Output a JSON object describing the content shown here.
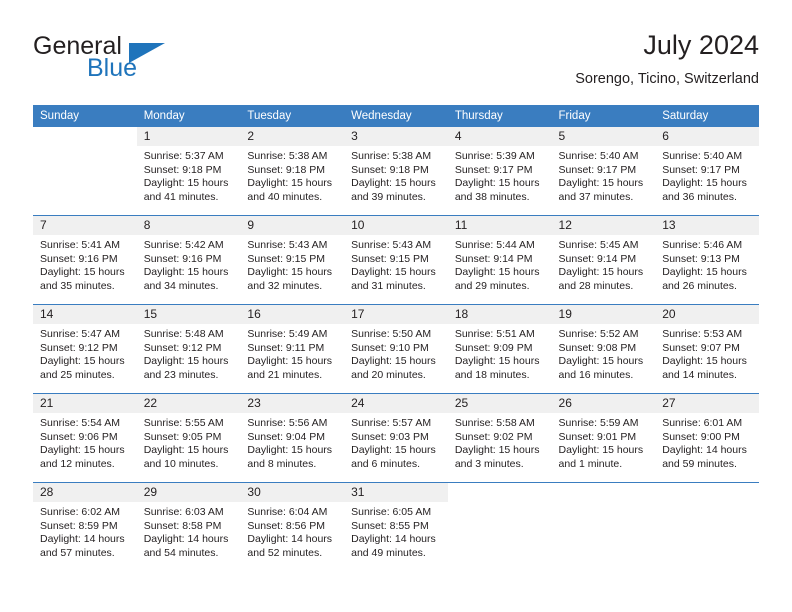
{
  "brand": {
    "name_part1": "General",
    "name_part2": "Blue",
    "triangle_icon": "triangle-icon"
  },
  "header": {
    "title": "July 2024",
    "location": "Sorengo, Ticino, Switzerland"
  },
  "colors": {
    "header_blue": "#3a7dc0",
    "brand_blue": "#1f74bb",
    "daynum_bg": "#f0f0f0",
    "text": "#231f20"
  },
  "weekdays": [
    "Sunday",
    "Monday",
    "Tuesday",
    "Wednesday",
    "Thursday",
    "Friday",
    "Saturday"
  ],
  "weeks": [
    [
      {
        "day": "",
        "sunrise": "",
        "sunset": "",
        "daylight1": "",
        "daylight2": ""
      },
      {
        "day": "1",
        "sunrise": "Sunrise: 5:37 AM",
        "sunset": "Sunset: 9:18 PM",
        "daylight1": "Daylight: 15 hours",
        "daylight2": "and 41 minutes."
      },
      {
        "day": "2",
        "sunrise": "Sunrise: 5:38 AM",
        "sunset": "Sunset: 9:18 PM",
        "daylight1": "Daylight: 15 hours",
        "daylight2": "and 40 minutes."
      },
      {
        "day": "3",
        "sunrise": "Sunrise: 5:38 AM",
        "sunset": "Sunset: 9:18 PM",
        "daylight1": "Daylight: 15 hours",
        "daylight2": "and 39 minutes."
      },
      {
        "day": "4",
        "sunrise": "Sunrise: 5:39 AM",
        "sunset": "Sunset: 9:17 PM",
        "daylight1": "Daylight: 15 hours",
        "daylight2": "and 38 minutes."
      },
      {
        "day": "5",
        "sunrise": "Sunrise: 5:40 AM",
        "sunset": "Sunset: 9:17 PM",
        "daylight1": "Daylight: 15 hours",
        "daylight2": "and 37 minutes."
      },
      {
        "day": "6",
        "sunrise": "Sunrise: 5:40 AM",
        "sunset": "Sunset: 9:17 PM",
        "daylight1": "Daylight: 15 hours",
        "daylight2": "and 36 minutes."
      }
    ],
    [
      {
        "day": "7",
        "sunrise": "Sunrise: 5:41 AM",
        "sunset": "Sunset: 9:16 PM",
        "daylight1": "Daylight: 15 hours",
        "daylight2": "and 35 minutes."
      },
      {
        "day": "8",
        "sunrise": "Sunrise: 5:42 AM",
        "sunset": "Sunset: 9:16 PM",
        "daylight1": "Daylight: 15 hours",
        "daylight2": "and 34 minutes."
      },
      {
        "day": "9",
        "sunrise": "Sunrise: 5:43 AM",
        "sunset": "Sunset: 9:15 PM",
        "daylight1": "Daylight: 15 hours",
        "daylight2": "and 32 minutes."
      },
      {
        "day": "10",
        "sunrise": "Sunrise: 5:43 AM",
        "sunset": "Sunset: 9:15 PM",
        "daylight1": "Daylight: 15 hours",
        "daylight2": "and 31 minutes."
      },
      {
        "day": "11",
        "sunrise": "Sunrise: 5:44 AM",
        "sunset": "Sunset: 9:14 PM",
        "daylight1": "Daylight: 15 hours",
        "daylight2": "and 29 minutes."
      },
      {
        "day": "12",
        "sunrise": "Sunrise: 5:45 AM",
        "sunset": "Sunset: 9:14 PM",
        "daylight1": "Daylight: 15 hours",
        "daylight2": "and 28 minutes."
      },
      {
        "day": "13",
        "sunrise": "Sunrise: 5:46 AM",
        "sunset": "Sunset: 9:13 PM",
        "daylight1": "Daylight: 15 hours",
        "daylight2": "and 26 minutes."
      }
    ],
    [
      {
        "day": "14",
        "sunrise": "Sunrise: 5:47 AM",
        "sunset": "Sunset: 9:12 PM",
        "daylight1": "Daylight: 15 hours",
        "daylight2": "and 25 minutes."
      },
      {
        "day": "15",
        "sunrise": "Sunrise: 5:48 AM",
        "sunset": "Sunset: 9:12 PM",
        "daylight1": "Daylight: 15 hours",
        "daylight2": "and 23 minutes."
      },
      {
        "day": "16",
        "sunrise": "Sunrise: 5:49 AM",
        "sunset": "Sunset: 9:11 PM",
        "daylight1": "Daylight: 15 hours",
        "daylight2": "and 21 minutes."
      },
      {
        "day": "17",
        "sunrise": "Sunrise: 5:50 AM",
        "sunset": "Sunset: 9:10 PM",
        "daylight1": "Daylight: 15 hours",
        "daylight2": "and 20 minutes."
      },
      {
        "day": "18",
        "sunrise": "Sunrise: 5:51 AM",
        "sunset": "Sunset: 9:09 PM",
        "daylight1": "Daylight: 15 hours",
        "daylight2": "and 18 minutes."
      },
      {
        "day": "19",
        "sunrise": "Sunrise: 5:52 AM",
        "sunset": "Sunset: 9:08 PM",
        "daylight1": "Daylight: 15 hours",
        "daylight2": "and 16 minutes."
      },
      {
        "day": "20",
        "sunrise": "Sunrise: 5:53 AM",
        "sunset": "Sunset: 9:07 PM",
        "daylight1": "Daylight: 15 hours",
        "daylight2": "and 14 minutes."
      }
    ],
    [
      {
        "day": "21",
        "sunrise": "Sunrise: 5:54 AM",
        "sunset": "Sunset: 9:06 PM",
        "daylight1": "Daylight: 15 hours",
        "daylight2": "and 12 minutes."
      },
      {
        "day": "22",
        "sunrise": "Sunrise: 5:55 AM",
        "sunset": "Sunset: 9:05 PM",
        "daylight1": "Daylight: 15 hours",
        "daylight2": "and 10 minutes."
      },
      {
        "day": "23",
        "sunrise": "Sunrise: 5:56 AM",
        "sunset": "Sunset: 9:04 PM",
        "daylight1": "Daylight: 15 hours",
        "daylight2": "and 8 minutes."
      },
      {
        "day": "24",
        "sunrise": "Sunrise: 5:57 AM",
        "sunset": "Sunset: 9:03 PM",
        "daylight1": "Daylight: 15 hours",
        "daylight2": "and 6 minutes."
      },
      {
        "day": "25",
        "sunrise": "Sunrise: 5:58 AM",
        "sunset": "Sunset: 9:02 PM",
        "daylight1": "Daylight: 15 hours",
        "daylight2": "and 3 minutes."
      },
      {
        "day": "26",
        "sunrise": "Sunrise: 5:59 AM",
        "sunset": "Sunset: 9:01 PM",
        "daylight1": "Daylight: 15 hours",
        "daylight2": "and 1 minute."
      },
      {
        "day": "27",
        "sunrise": "Sunrise: 6:01 AM",
        "sunset": "Sunset: 9:00 PM",
        "daylight1": "Daylight: 14 hours",
        "daylight2": "and 59 minutes."
      }
    ],
    [
      {
        "day": "28",
        "sunrise": "Sunrise: 6:02 AM",
        "sunset": "Sunset: 8:59 PM",
        "daylight1": "Daylight: 14 hours",
        "daylight2": "and 57 minutes."
      },
      {
        "day": "29",
        "sunrise": "Sunrise: 6:03 AM",
        "sunset": "Sunset: 8:58 PM",
        "daylight1": "Daylight: 14 hours",
        "daylight2": "and 54 minutes."
      },
      {
        "day": "30",
        "sunrise": "Sunrise: 6:04 AM",
        "sunset": "Sunset: 8:56 PM",
        "daylight1": "Daylight: 14 hours",
        "daylight2": "and 52 minutes."
      },
      {
        "day": "31",
        "sunrise": "Sunrise: 6:05 AM",
        "sunset": "Sunset: 8:55 PM",
        "daylight1": "Daylight: 14 hours",
        "daylight2": "and 49 minutes."
      },
      {
        "day": "",
        "sunrise": "",
        "sunset": "",
        "daylight1": "",
        "daylight2": ""
      },
      {
        "day": "",
        "sunrise": "",
        "sunset": "",
        "daylight1": "",
        "daylight2": ""
      },
      {
        "day": "",
        "sunrise": "",
        "sunset": "",
        "daylight1": "",
        "daylight2": ""
      }
    ]
  ]
}
